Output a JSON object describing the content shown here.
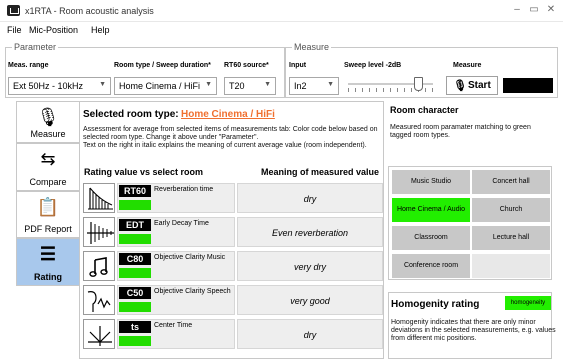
{
  "window": {
    "title": "x1RTA - Room acoustic analysis"
  },
  "menu": [
    "File",
    "Mic-Position",
    "Help"
  ],
  "parameter": {
    "group_label": "Parameter",
    "meas_range_label": "Meas. range",
    "meas_range_value": "Ext 50Hz - 10kHz",
    "room_type_label": "Room type / Sweep duration*",
    "room_type_value": "Home Cinema / HiFi",
    "rt60_label": "RT60 source*",
    "rt60_value": "T20"
  },
  "measure": {
    "group_label": "Measure",
    "input_label": "Input",
    "input_value": "In2",
    "sweep_label": "Sweep level -2dB",
    "measure_label": "Measure",
    "start_label": "Start"
  },
  "tabs": [
    {
      "label": "Measure",
      "icon": "microphone-icon",
      "glyph": "🎙"
    },
    {
      "label": "Compare",
      "icon": "compare-icon",
      "glyph": "⇆"
    },
    {
      "label": "PDF Report",
      "icon": "report-icon",
      "glyph": "📋"
    },
    {
      "label": "Rating",
      "icon": "rating-icon",
      "glyph": "☰"
    }
  ],
  "main": {
    "selected_label": "Selected room type:",
    "selected_value": "Home Cinema / HiFi",
    "desc_line1": "Assessment for average from selected items of measurements tab: Color code below based on",
    "desc_line2": "selected room type. Change it above under \"Parameter\".",
    "desc_line3": "Text on the right in italic explains the meaning of current average value (room independent).",
    "col_rating": "Rating value vs select room",
    "col_meaning": "Meaning of measured value",
    "params": [
      {
        "code": "RT60",
        "name": "Reverberation time",
        "meaning": "dry",
        "icon": "reverberation-icon"
      },
      {
        "code": "EDT",
        "name": "Early Decay Time",
        "meaning": "Even reverberation",
        "icon": "decay-icon"
      },
      {
        "code": "C80",
        "name": "Objective Clarity Music",
        "meaning": "very dry",
        "icon": "music-note-icon"
      },
      {
        "code": "C50",
        "name": "Objective Clarity Speech",
        "meaning": "very good",
        "icon": "speech-icon"
      },
      {
        "code": "ts",
        "name": "Center Time",
        "meaning": "dry",
        "icon": "center-time-icon"
      }
    ]
  },
  "room_character": {
    "title": "Room character",
    "desc_line1": "Measured room paramater matching to green",
    "desc_line2": "tagged room types.",
    "rooms": [
      {
        "label": "Music Studio",
        "match": false
      },
      {
        "label": "Concert hall",
        "match": false
      },
      {
        "label": "Home Cinema / Audio",
        "match": true
      },
      {
        "label": "Church",
        "match": false
      },
      {
        "label": "Classroom",
        "match": false
      },
      {
        "label": "Lecture hall",
        "match": false
      },
      {
        "label": "Conference room",
        "match": false
      },
      {
        "label": "",
        "match": false
      }
    ]
  },
  "homogenity": {
    "title": "Homogenity rating",
    "badge": "homogeneity",
    "desc_line1": "Homogenity indicates that there are only minor",
    "desc_line2": "deviations in the selected measurements, e.g. values",
    "desc_line3": "from different mic positions."
  },
  "colors": {
    "match": "#22ee00",
    "accent": "#f07030",
    "active_tab": "#a8c8ec"
  }
}
